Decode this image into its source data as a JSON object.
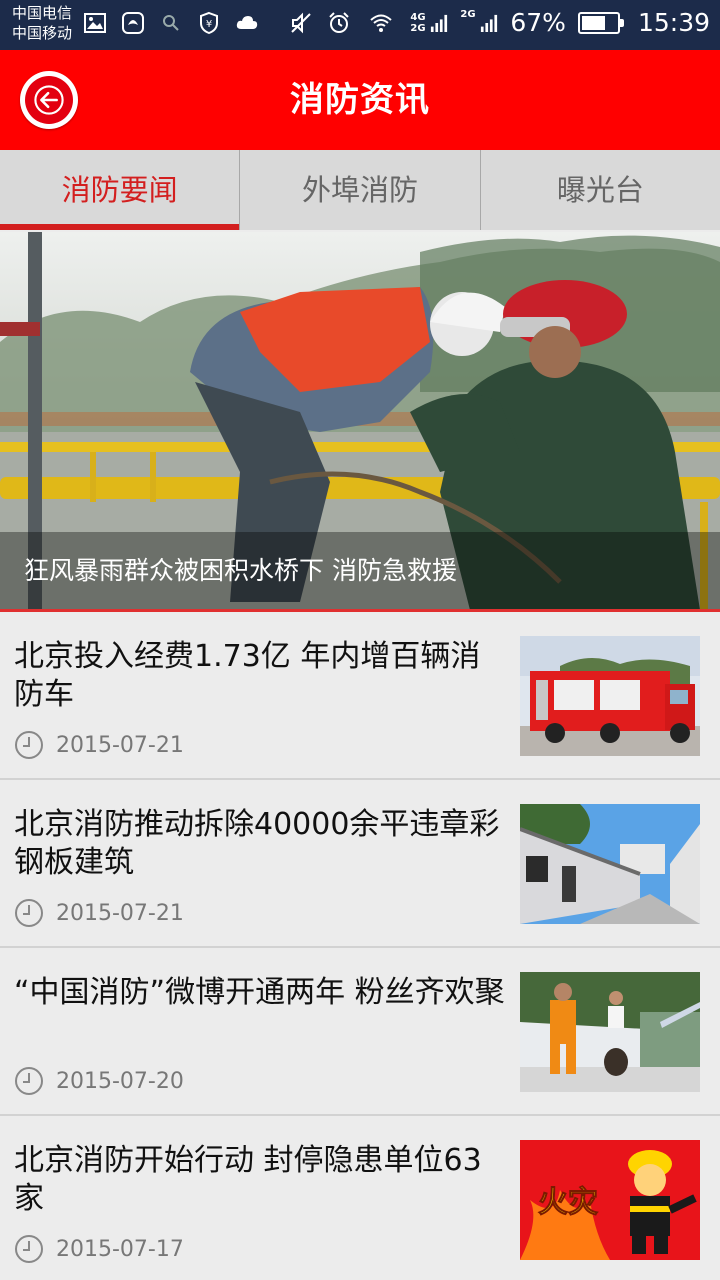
{
  "status_bar": {
    "carrier1": "中国电信",
    "carrier2": "中国移动",
    "net_top": "4G",
    "net_bottom": "2G",
    "net2": "2G",
    "battery_pct": "67%",
    "battery_level": 0.67,
    "time": "15:39"
  },
  "header": {
    "title": "消防资讯",
    "back_icon": "back-arrow-icon",
    "brand_color": "#ff0000"
  },
  "tabs": [
    {
      "label": "消防要闻",
      "active": true
    },
    {
      "label": "外埠消防",
      "active": false
    },
    {
      "label": "曝光台",
      "active": false
    }
  ],
  "banner": {
    "caption": "狂风暴雨群众被困积水桥下 消防急救援"
  },
  "news": [
    {
      "title": "北京投入经费1.73亿 年内增百辆消防车",
      "date": "2015-07-21",
      "thumb": "fire-truck-photo"
    },
    {
      "title": "北京消防推动拆除40000余平违章彩钢板建筑",
      "date": "2015-07-21",
      "thumb": "steel-buildings-photo"
    },
    {
      "title": "“中国消防”微博开通两年 粉丝齐欢聚",
      "date": "2015-07-20",
      "thumb": "firefighter-photo"
    },
    {
      "title": "北京消防开始行动 封停隐患单位63家",
      "date": "2015-07-17",
      "thumb": "fire-cartoon",
      "thumb_text": "火灾"
    }
  ]
}
